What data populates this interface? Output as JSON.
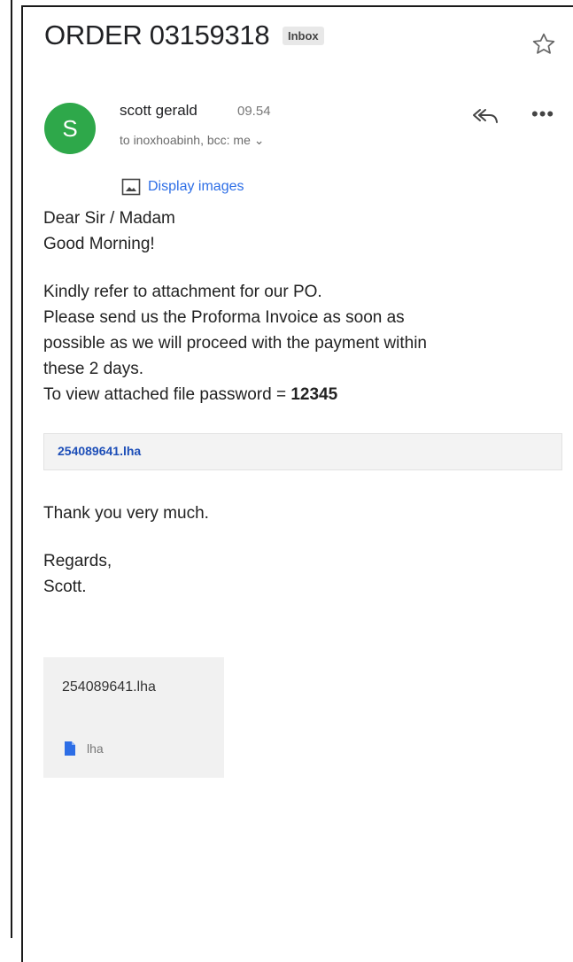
{
  "message": {
    "subject": "ORDER 03159318",
    "badge": "Inbox",
    "sender": {
      "avatar_letter": "S",
      "name": "scott gerald",
      "time": "09.54",
      "recipients": "to inoxhoabinh, bcc: me ⌄"
    },
    "display_images_label": "Display images",
    "body": {
      "greeting_1": "Dear Sir / Madam",
      "greeting_2": "Good Morning!",
      "line_1": "Kindly refer to attachment for our PO.",
      "line_2": "Please send us the Proforma Invoice as soon as",
      "line_3": "possible as we will proceed with the payment within",
      "line_4": "these 2 days.",
      "line_5_prefix": "To view attached file password = ",
      "line_5_password": "12345"
    },
    "inline_attachment": "254089641.lha",
    "closing": {
      "thanks": "Thank you very much.",
      "regards": "Regards,",
      "signature": "Scott."
    },
    "attachment": {
      "name": "254089641.lha",
      "type": "lha"
    }
  },
  "icons": {
    "star": "star-outline-icon",
    "reply_all": "reply-all-icon",
    "more": "more-horizontal-icon",
    "image": "image-icon",
    "file": "file-icon"
  },
  "colors": {
    "avatar": "#2ea84a",
    "link": "#2d6ee6",
    "attachment_link": "#1e4fb8"
  }
}
